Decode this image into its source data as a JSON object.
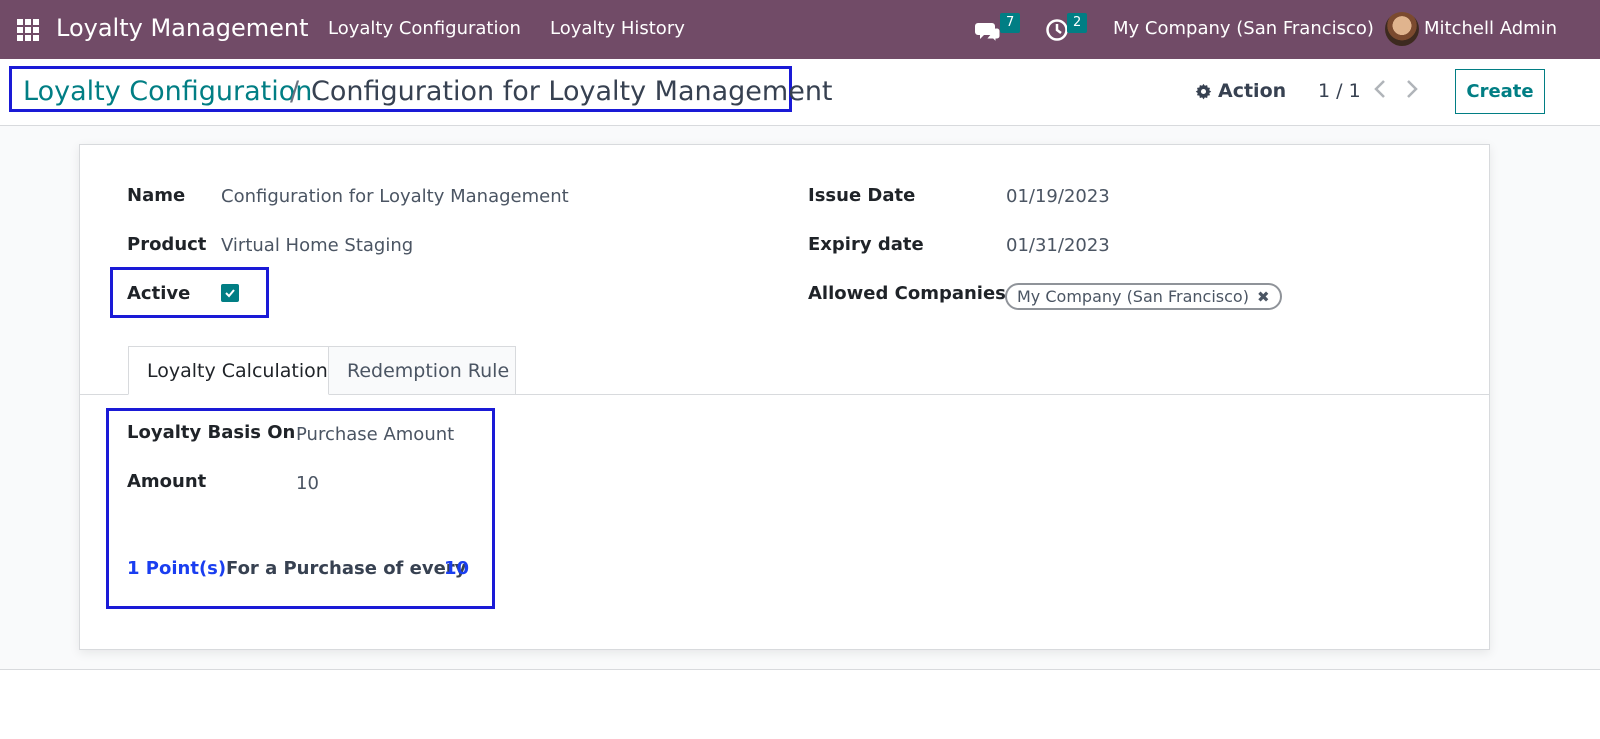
{
  "navbar": {
    "app_title": "Loyalty Management",
    "menu": [
      "Loyalty Configuration",
      "Loyalty History"
    ],
    "messages_count": "7",
    "activities_count": "2",
    "company": "My Company (San Francisco)",
    "user": "Mitchell Admin",
    "bg_color": "#714b67"
  },
  "breadcrumb": {
    "parent": "Loyalty Configuration",
    "separator": "/",
    "current": "Configuration for Loyalty Management"
  },
  "toolbar": {
    "action_label": "Action",
    "pager": "1 / 1",
    "create_label": "Create"
  },
  "form": {
    "name_label": "Name",
    "name_value": "Configuration for Loyalty Management",
    "product_label": "Product",
    "product_value": "Virtual Home Staging",
    "active_label": "Active",
    "active_checked": true,
    "issue_date_label": "Issue Date",
    "issue_date_value": "01/19/2023",
    "expiry_date_label": "Expiry date",
    "expiry_date_value": "01/31/2023",
    "allowed_companies_label": "Allowed Companies",
    "allowed_companies_tag": "My Company (San Francisco)"
  },
  "tabs": [
    {
      "label": "Loyalty Calculation",
      "active": true
    },
    {
      "label": "Redemption Rule",
      "active": false
    }
  ],
  "calculation": {
    "basis_label": "Loyalty Basis On",
    "basis_value": "Purchase Amount",
    "amount_label": "Amount",
    "amount_value": "10",
    "points_text": "1 Point(s)",
    "for_text": "For a Purchase of every",
    "every_value": "10"
  },
  "colors": {
    "accent": "#017e84",
    "highlight_box": "#1a1ad6"
  }
}
